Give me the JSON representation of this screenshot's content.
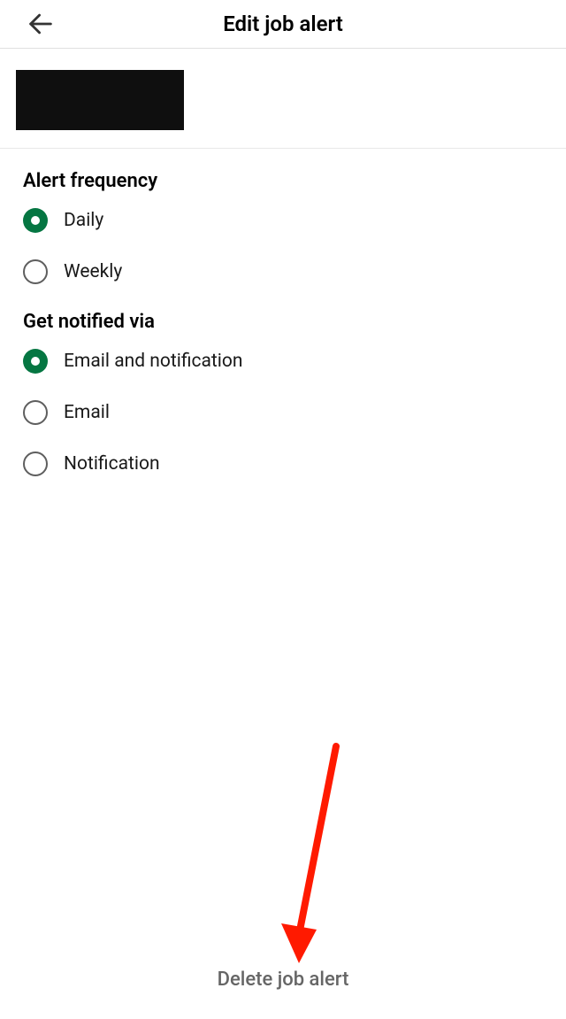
{
  "header": {
    "title": "Edit job alert"
  },
  "sections": {
    "frequency": {
      "heading": "Alert frequency",
      "options": [
        {
          "label": "Daily",
          "selected": true
        },
        {
          "label": "Weekly",
          "selected": false
        }
      ]
    },
    "notification": {
      "heading": "Get notified via",
      "options": [
        {
          "label": "Email and notification",
          "selected": true
        },
        {
          "label": "Email",
          "selected": false
        },
        {
          "label": "Notification",
          "selected": false
        }
      ]
    }
  },
  "actions": {
    "delete": "Delete job alert"
  },
  "colors": {
    "accent": "#057642",
    "text": "#191919",
    "muted": "#666666",
    "annotation": "#ff1a00"
  }
}
